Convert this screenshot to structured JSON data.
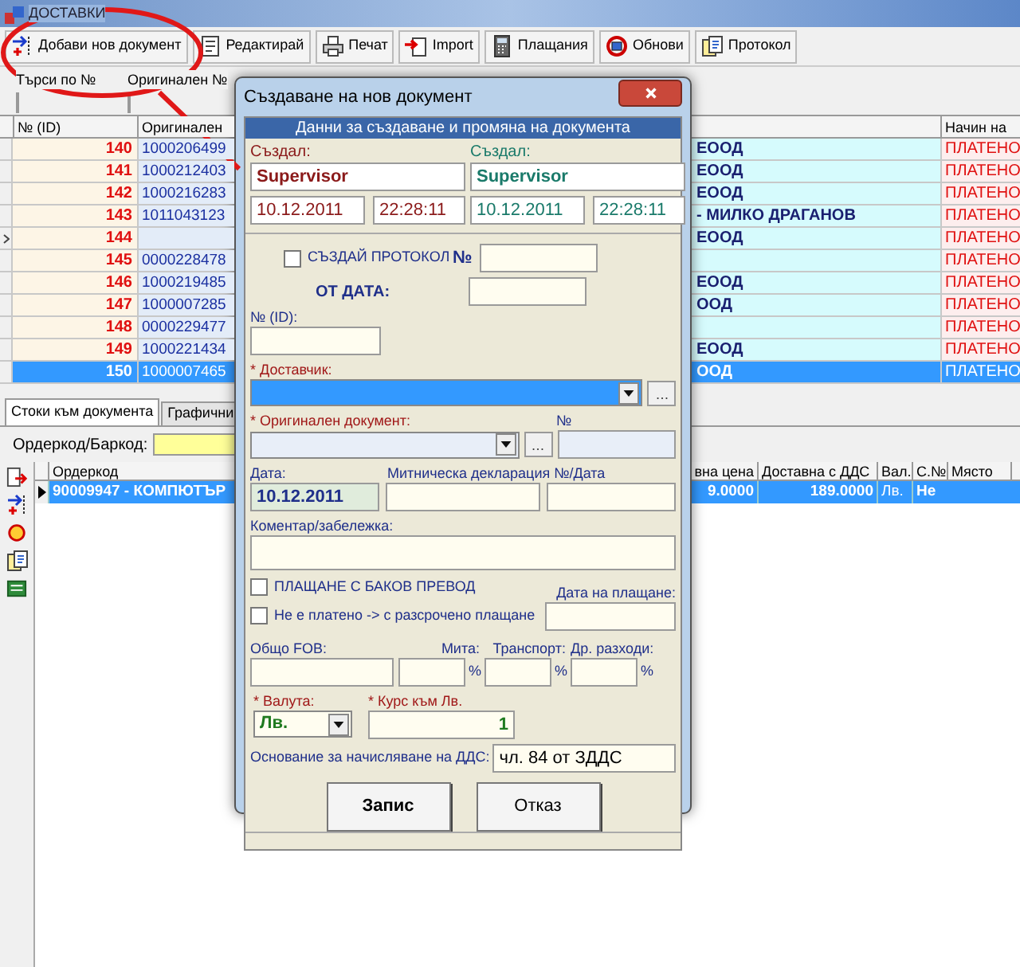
{
  "window": {
    "title": "ДОСТАВКИ"
  },
  "toolbar": [
    {
      "label": "Добави нов документ",
      "kind": "add"
    },
    {
      "label": "Редактирай",
      "kind": "edit"
    },
    {
      "label": "Печат",
      "kind": "print"
    },
    {
      "label": "Import",
      "kind": "import"
    },
    {
      "label": "Плащания",
      "kind": "payments"
    },
    {
      "label": "Обнови",
      "kind": "refresh"
    },
    {
      "label": "Протокол",
      "kind": "protocol"
    }
  ],
  "search": [
    {
      "label": "Търси по №"
    },
    {
      "label": "Оригинален №"
    }
  ],
  "table": {
    "columns": [
      "№ (ID)",
      "Оригинален",
      "Начин на"
    ],
    "rows": [
      {
        "id": "140",
        "original": "1000206499",
        "supplier": "ЕООД",
        "payment": "ПЛАТЕНО",
        "selected": false
      },
      {
        "id": "141",
        "original": "1000212403",
        "supplier": "ЕООД",
        "payment": "ПЛАТЕНО",
        "selected": false
      },
      {
        "id": "142",
        "original": "1000216283",
        "supplier": "ЕООД",
        "payment": "ПЛАТЕНО",
        "selected": false
      },
      {
        "id": "143",
        "original": "1011043123",
        "supplier": "- МИЛКО ДРАГАНОВ",
        "payment": "ПЛАТЕНО",
        "selected": false
      },
      {
        "id": "144",
        "supplier": "ЕООД",
        "payment": "ПЛАТЕНО",
        "selected": false,
        "current": true
      },
      {
        "id": "145",
        "original": "0000228478",
        "payment": "ПЛАТЕНО",
        "selected": false
      },
      {
        "id": "146",
        "original": "1000219485",
        "supplier": "ЕООД",
        "payment": "ПЛАТЕНО",
        "selected": false
      },
      {
        "id": "147",
        "original": "1000007285",
        "supplier": "ООД",
        "payment": "ПЛАТЕНО",
        "selected": false
      },
      {
        "id": "148",
        "original": "0000229477",
        "payment": "ПЛАТЕНО",
        "selected": false
      },
      {
        "id": "149",
        "original": "1000221434",
        "supplier": "ЕООД",
        "payment": "ПЛАТЕНО",
        "selected": false
      },
      {
        "id": "150",
        "original": "1000007465",
        "supplier": "ООД",
        "payment": "ПЛАТЕНО",
        "selected": true
      }
    ]
  },
  "tabs": [
    {
      "label": "Стоки към документа",
      "selected": true
    },
    {
      "label": "Графични",
      "selected": false
    }
  ],
  "barcode_label": "Ордеркод/Баркод:",
  "items": {
    "columns": [
      "Ордеркод",
      "вна цена",
      "Доставна с ДДС",
      "Вал.",
      "С.№",
      "Място"
    ],
    "rows": [
      {
        "cells": [
          "90009947 - КОМПЮТЪР",
          "9.0000",
          "189.0000",
          "Лв.",
          "Не"
        ],
        "selected": true
      }
    ]
  },
  "dialog": {
    "title": "Създаване на нов документ",
    "header": "Данни за създаване и промяна на документа",
    "created": [
      {
        "label": "Създал:",
        "user": "Supervisor",
        "date": "10.12.2011",
        "time": "22:28:11",
        "color": "#8b1a1a"
      },
      {
        "label": "Създал:",
        "user": "Supervisor",
        "date": "10.12.2011",
        "time": "22:28:11",
        "color": "#1a7a6a"
      }
    ],
    "protocol": {
      "label": "СЪЗДАЙ ПРОТОКОЛ",
      "checked": false,
      "number_label": "№",
      "date_label": "ОТ ДАТА:"
    },
    "id_label": "№ (ID):",
    "supplier_label": "* Доставчик:",
    "original_doc_label": "* Оригинален документ:",
    "number_label": "№",
    "date_label": "Дата:",
    "date_value": "10.12.2011",
    "customs_label": "Митническа декларация №/Дата",
    "comment_label": "Коментар/забележка:",
    "checks": [
      {
        "label": "ПЛАЩАНЕ С БАКОВ ПРЕВОД",
        "checked": false
      },
      {
        "label": "Не е платено -> с разсрочено плащане",
        "checked": false
      }
    ],
    "payment_date_label": "Дата на плащане:",
    "costs": [
      {
        "label": "Общо FOB:"
      },
      {
        "label": "Мита:",
        "unit": "%"
      },
      {
        "label": "Транспорт:",
        "unit": "%"
      },
      {
        "label": "Др. разходи:",
        "unit": "%"
      }
    ],
    "currency": {
      "label": "* Валута:",
      "value": "Лв."
    },
    "rate": {
      "label": "* Курс към Лв.",
      "value": "1"
    },
    "vat": {
      "label": "Основание за начисляване на ДДС:",
      "value": "чл. 84 от ЗДДС"
    },
    "buttons": [
      "Запис",
      "Отказ"
    ]
  }
}
